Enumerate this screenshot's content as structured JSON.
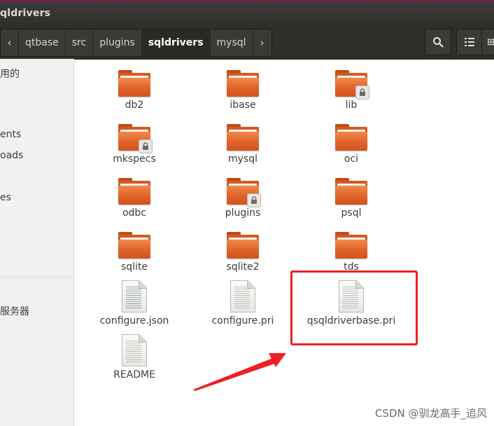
{
  "window": {
    "title": "qldrivers"
  },
  "pathbar": {
    "back_glyph": "‹",
    "forward_glyph": "›",
    "crumbs": [
      "qtbase",
      "src",
      "plugins",
      "sqldrivers",
      "mysql"
    ],
    "active_crumb": "sqldrivers"
  },
  "sidebar": {
    "items": [
      "用的",
      "ents",
      "oads",
      "es",
      "服务器"
    ]
  },
  "files": [
    {
      "name": "db2",
      "type": "folder"
    },
    {
      "name": "ibase",
      "type": "folder"
    },
    {
      "name": "lib",
      "type": "folder-locked"
    },
    {
      "name": "mkspecs",
      "type": "folder-locked"
    },
    {
      "name": "mysql",
      "type": "folder"
    },
    {
      "name": "oci",
      "type": "folder"
    },
    {
      "name": "odbc",
      "type": "folder"
    },
    {
      "name": "plugins",
      "type": "folder-locked"
    },
    {
      "name": "psql",
      "type": "folder"
    },
    {
      "name": "sqlite",
      "type": "folder"
    },
    {
      "name": "sqlite2",
      "type": "folder"
    },
    {
      "name": "tds",
      "type": "folder"
    },
    {
      "name": "configure.json",
      "type": "json-file"
    },
    {
      "name": "configure.pri",
      "type": "text-file"
    },
    {
      "name": "qsqldriverbase.pri",
      "type": "text-file"
    },
    {
      "name": "README",
      "type": "text-file"
    }
  ],
  "annotation": {
    "highlighted_file": "qsqldriverbase.pri",
    "color": "#ee2020"
  },
  "watermark": "CSDN @驯龙高手_追风",
  "colors": {
    "accent": "#e0622a",
    "titlebar": "#302f2c"
  }
}
